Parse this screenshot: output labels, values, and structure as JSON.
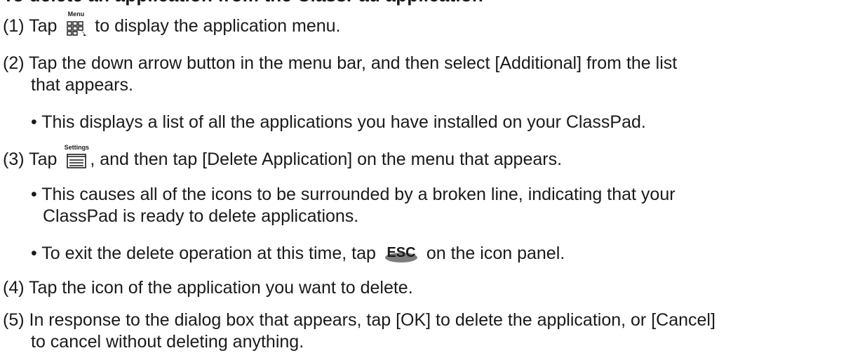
{
  "heading": "To delete an application from the ClassPad application",
  "steps": {
    "s1": {
      "num": "(1)",
      "before": "Tap",
      "icon_caption": "Menu",
      "icon": "menu-icon",
      "after": "to display the application menu."
    },
    "s2": {
      "line1": "(2) Tap the down arrow button in the menu bar, and then select [Additional] from the list",
      "line2": "that appears."
    },
    "s2_bullet": "• This displays a list of all the applications you have installed on your ClassPad.",
    "s3": {
      "num": "(3)",
      "before": "Tap",
      "icon_caption": "Settings",
      "icon": "settings-icon",
      "after": ", and then tap [Delete Application] on the menu that appears."
    },
    "s3_bullet1": {
      "line1": "• This causes all of the icons to be surrounded by a broken line, indicating that your",
      "line2": "ClassPad is ready to delete applications."
    },
    "s3_bullet2": {
      "before": "• To exit the delete operation at this time, tap",
      "key_label": "ESC",
      "after": "on the icon panel."
    },
    "s4": "(4) Tap the icon of the application you want to delete.",
    "s5": {
      "line1": "(5) In response to the dialog box that appears, tap [OK] to delete the application, or [Cancel]",
      "line2": "to cancel without deleting anything."
    }
  },
  "colors": {
    "text": "#1a1a1a",
    "esc_key": "#7d7d7d"
  }
}
